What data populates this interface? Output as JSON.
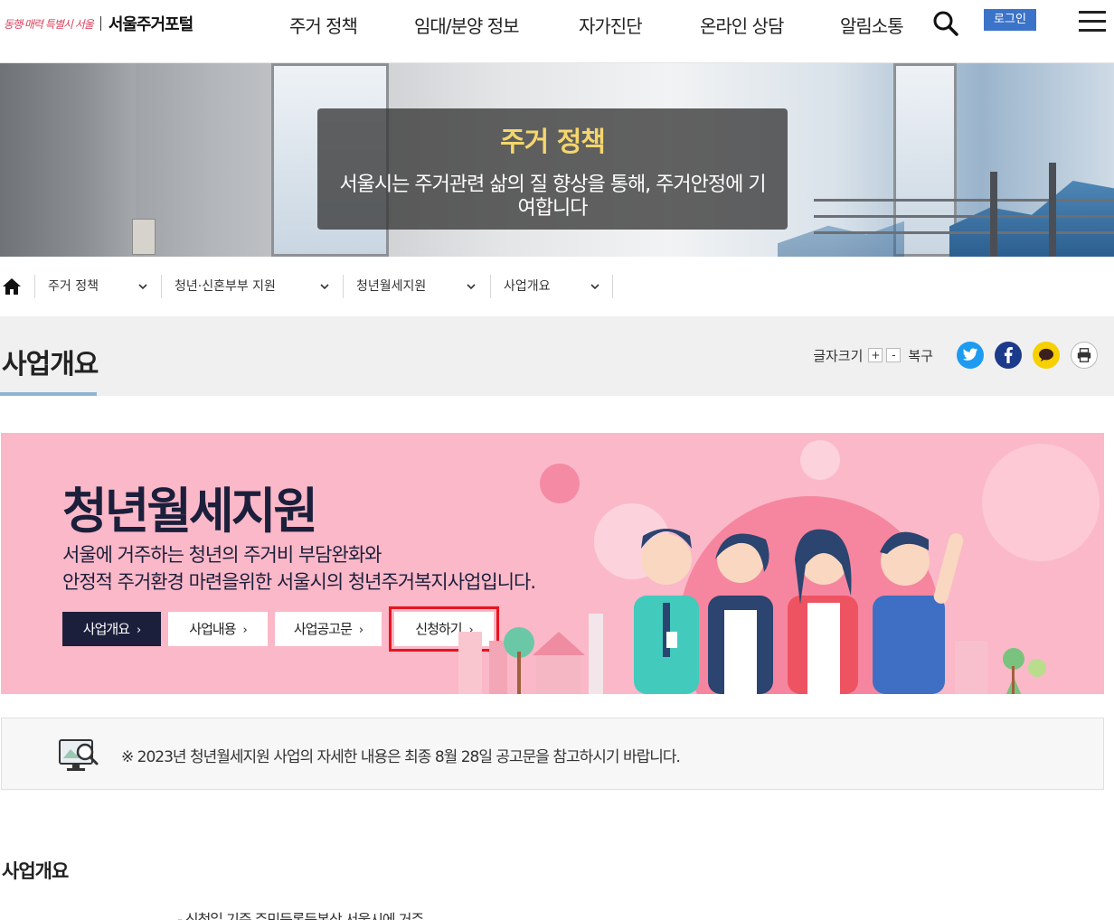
{
  "header": {
    "logo_slogan": "동행·매력 특별시 서울",
    "logo_name": "서울주거포털",
    "nav": [
      "주거 정책",
      "임대/분양 정보",
      "자가진단",
      "온라인 상담",
      "알림소통"
    ],
    "login_label": "로그인"
  },
  "hero": {
    "title": "주거 정책",
    "description": "서울시는 주거관련 삶의 질 향상을 통해, 주거안정에 기여합니다"
  },
  "breadcrumb": [
    "주거 정책",
    "청년·신혼부부 지원",
    "청년월세지원",
    "사업개요"
  ],
  "title_bar": {
    "page_title": "사업개요",
    "font_size_label": "글자크기",
    "plus": "+",
    "minus": "-",
    "reset_label": "복구"
  },
  "banner": {
    "title": "청년월세지원",
    "desc_line1": "서울에 거주하는 청년의 주거비 부담완화와",
    "desc_line2": "안정적 주거환경 마련을위한 서울시의 청년주거복지사업입니다.",
    "buttons": [
      {
        "label": "사업개요",
        "active": true
      },
      {
        "label": "사업내용",
        "active": false
      },
      {
        "label": "사업공고문",
        "active": false
      },
      {
        "label": "신청하기",
        "active": false,
        "highlighted": true
      }
    ]
  },
  "notice": {
    "text": "※ 2023년 청년월세지원 사업의 자세한 내용은 최종 8월 28일 공고문을 참고하시기 바랍니다."
  },
  "section": {
    "title": "사업개요",
    "first_line": "- 신청일 기준 주민등록등본상 서울시에 거주"
  },
  "colors": {
    "banner_bg": "#fbb8c8",
    "banner_text": "#1b1f3b",
    "hero_title": "#f5d66b",
    "login_bg": "#3b73c8",
    "highlight": "#e8141f"
  }
}
